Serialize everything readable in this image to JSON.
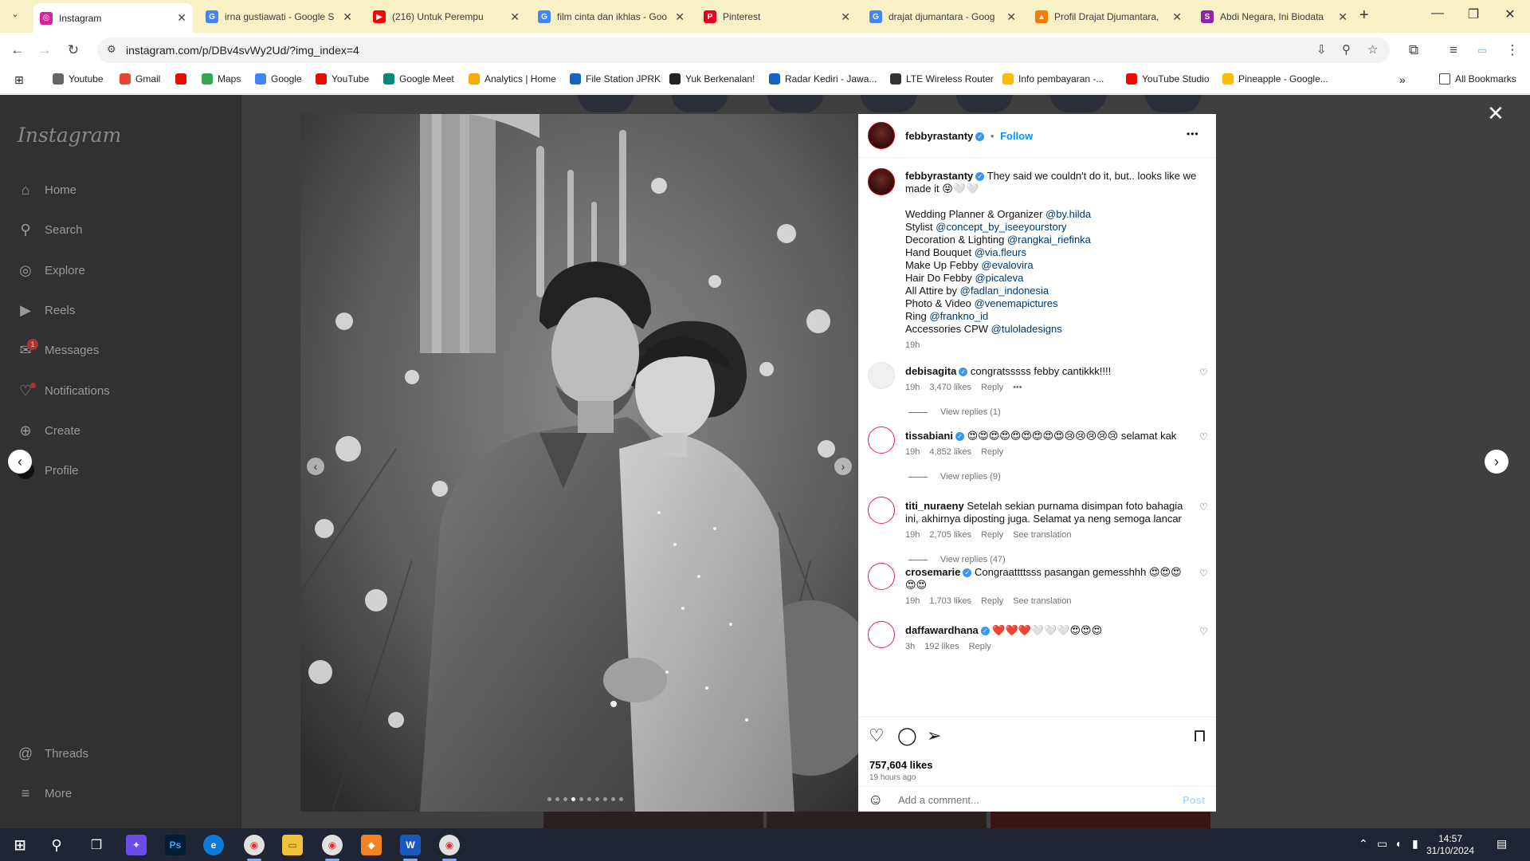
{
  "tabs": [
    {
      "title": "Instagram",
      "color": "#d6249f",
      "glyph": "◎",
      "active": true
    },
    {
      "title": "irna gustiawati - Google S",
      "color": "#4285f4",
      "glyph": "G"
    },
    {
      "title": "(216) Untuk Perempu",
      "color": "#ff0000",
      "glyph": "▶"
    },
    {
      "title": "film cinta dan ikhlas - Goo",
      "color": "#4285f4",
      "glyph": "G"
    },
    {
      "title": "Pinterest",
      "color": "#e60023",
      "glyph": "P"
    },
    {
      "title": "drajat djumantara - Goog",
      "color": "#4285f4",
      "glyph": "G"
    },
    {
      "title": "Profil Drajat Djumantara,",
      "color": "#f57c00",
      "glyph": "▲"
    },
    {
      "title": "Abdi Negara, Ini Biodata",
      "color": "#8e24aa",
      "glyph": "S"
    }
  ],
  "address": {
    "url": "instagram.com/p/DBv4svWy2Ud/?img_index=4"
  },
  "bookmarks": [
    {
      "label": "Youtube",
      "color": "#666"
    },
    {
      "label": "Gmail",
      "color": "#ea4335"
    },
    {
      "label": "",
      "color": "#ff0000"
    },
    {
      "label": "Maps",
      "color": "#34a853"
    },
    {
      "label": "Google",
      "color": "#4285f4"
    },
    {
      "label": "YouTube",
      "color": "#ff0000"
    },
    {
      "label": "Google Meet",
      "color": "#00897b"
    },
    {
      "label": "Analytics | Home",
      "color": "#f9ab00"
    },
    {
      "label": "File Station JPRK",
      "color": "#1565c0"
    },
    {
      "label": "Yuk Berkenalan!",
      "color": "#222"
    },
    {
      "label": "Radar Kediri - Jawa...",
      "color": "#1565c0"
    },
    {
      "label": "LTE Wireless Router",
      "color": "#333"
    },
    {
      "label": "Info pembayaran -...",
      "color": "#fbbc04"
    },
    {
      "label": "YouTube Studio",
      "color": "#ff0000"
    },
    {
      "label": "Pineapple - Google...",
      "color": "#fbbc04"
    }
  ],
  "all_bookmarks": "All Bookmarks",
  "instagram": {
    "logo": "Instagram",
    "nav": [
      "Home",
      "Search",
      "Explore",
      "Reels",
      "Messages",
      "Notifications",
      "Create",
      "Profile"
    ],
    "messages_badge": "1",
    "nav_bottom": [
      "Threads",
      "More"
    ]
  },
  "post": {
    "username": "febbyrastanty",
    "follow": "Follow",
    "more": "•••",
    "caption_first": "They said we couldn't do it, but.. looks like we made it 😝🤍🤍",
    "credits": [
      {
        "label": "Wedding Planner & Organizer",
        "mention": "@by.hilda"
      },
      {
        "label": "Stylist",
        "mention": "@concept_by_iseeyourstory"
      },
      {
        "label": "Decoration & Lighting",
        "mention": "@rangkai_riefinka"
      },
      {
        "label": "Hand Bouquet",
        "mention": "@via.fleurs"
      },
      {
        "label": "Make Up Febby",
        "mention": "@evalovira"
      },
      {
        "label": "Hair Do Febby",
        "mention": "@picaleva"
      },
      {
        "label": "All Attire by",
        "mention": "@fadlan_indonesia"
      },
      {
        "label": "Photo & Video",
        "mention": "@venemapictures"
      },
      {
        "label": "Ring",
        "mention": "@frankno_id"
      },
      {
        "label": "Accessories CPW",
        "mention": "@tuloladesigns"
      }
    ],
    "caption_time": "19h",
    "comments": [
      {
        "user": "debisagita",
        "verified": true,
        "text": "congratsssss febby cantikkk!!!!",
        "time": "19h",
        "likes": "3,470 likes",
        "reply": "Reply",
        "extra": "•••",
        "view": "View replies (1)",
        "avatar": "grey"
      },
      {
        "user": "tissabiani",
        "verified": true,
        "text": "😍😍😍😍😍😍😍😍😍😢😢😢😢😢 selamat kak",
        "time": "19h",
        "likes": "4,852 likes",
        "reply": "Reply",
        "extra": "",
        "view": "View replies (9)",
        "avatar": "ring"
      },
      {
        "user": "titi_nuraeny",
        "verified": false,
        "text": "Setelah sekian purnama disimpan foto bahagia ini, akhirnya diposting juga. Selamat ya neng semoga lancar",
        "time": "19h",
        "likes": "2,705 likes",
        "reply": "Reply",
        "extra": "See translation",
        "view": "View replies (47)",
        "avatar": "ring"
      },
      {
        "user": "crosemarie",
        "verified": true,
        "text": "Congraattttsss pasangan gemesshhh 😍😍😍😍😍",
        "time": "19h",
        "likes": "1,703 likes",
        "reply": "Reply",
        "extra": "See translation",
        "view": "",
        "avatar": "ring"
      },
      {
        "user": "daffawardhana",
        "verified": true,
        "text": "❤️❤️❤️🤍🤍🤍😍😍😍",
        "time": "3h",
        "likes": "192 likes",
        "reply": "Reply",
        "extra": "",
        "view": "",
        "avatar": "ring"
      }
    ],
    "likes": "757,604 likes",
    "ago": "19 hours ago",
    "add_comment": "Add a comment...",
    "post_btn": "Post",
    "carousel": {
      "count": 10,
      "current": 4
    }
  },
  "taskbar": {
    "time": "14:57",
    "date": "31/10/2024"
  }
}
